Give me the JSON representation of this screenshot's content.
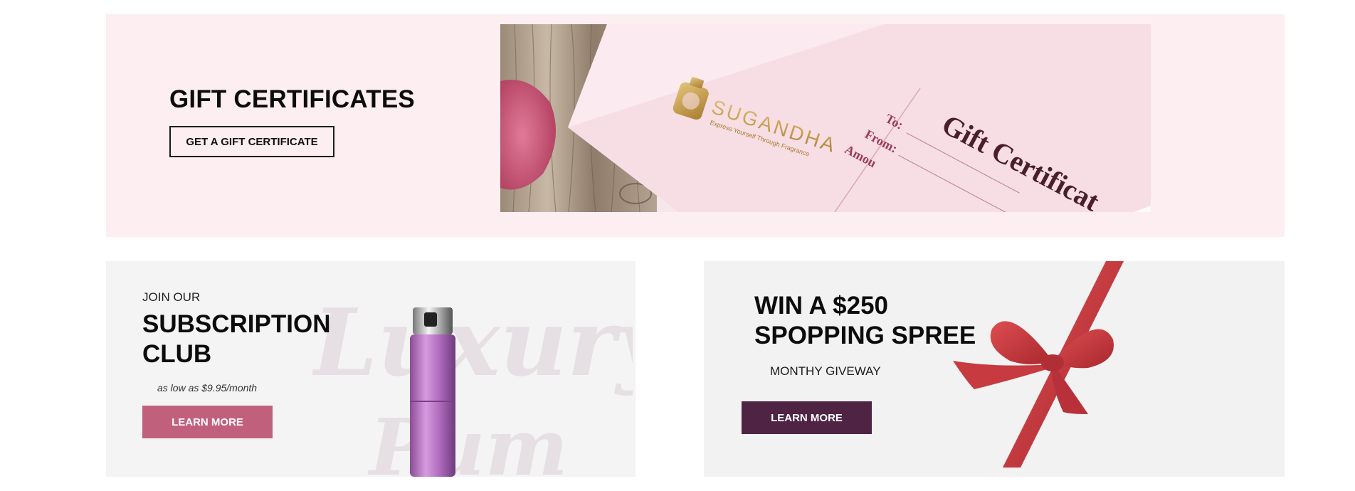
{
  "gift": {
    "title": "GIFT CERTIFICATES",
    "button_label": "GET A GIFT CERTIFICATE",
    "image": {
      "brand": "SUGANDHA",
      "tagline": "Express Yourself Through Fragrance",
      "heading": "Gift Certificat",
      "field_to": "To:",
      "field_from": "From:",
      "field_amount": "Amou"
    }
  },
  "subscription": {
    "pre_title": "JOIN OUR",
    "title_line1": "SUBSCRIPTION",
    "title_line2": "CLUB",
    "price_note": "as low as $9.95/month",
    "button_label": "LEARN MORE",
    "watermark_line1": "Luxury",
    "watermark_line2": "Pum"
  },
  "contest": {
    "title_line1": "WIN A $250",
    "title_line2": "SPOPPING SPREE",
    "subtitle": "MONTHY GIVEWAY",
    "button_label": "LEARN MORE"
  },
  "colors": {
    "gift_banner_bg": "#fdeef2",
    "card_bg": "#f4f4f4",
    "subscription_button": "#c0607c",
    "contest_button": "#4e2343",
    "ribbon": "#c9383d",
    "gold": "#c9a04a"
  }
}
